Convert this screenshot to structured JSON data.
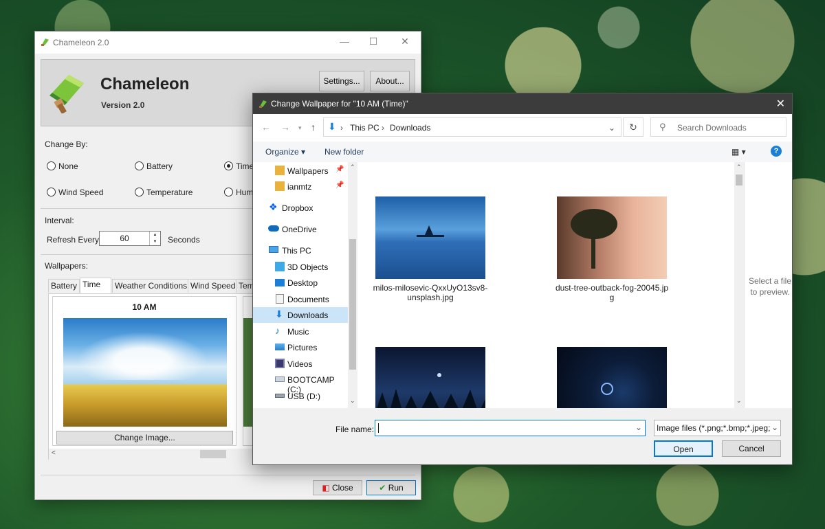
{
  "chameleon": {
    "window_title": "Chameleon 2.0",
    "app_name": "Chameleon",
    "version": "Version 2.0",
    "settings_label": "Settings...",
    "about_label": "About...",
    "change_by_label": "Change By:",
    "options": [
      "None",
      "Battery",
      "Time",
      "Wind Speed",
      "Temperature",
      "Hum"
    ],
    "selected_option": "Time",
    "interval_label": "Interval:",
    "refresh_every_label": "Refresh Every",
    "refresh_value": "60",
    "seconds_label": "Seconds",
    "wallpapers_label": "Wallpapers:",
    "tabs": [
      "Battery",
      "Time",
      "Weather Conditions",
      "Wind Speed",
      "Tem"
    ],
    "active_tab": "Time",
    "card_title": "10 AM",
    "change_image_label": "Change Image...",
    "close_label": "Close",
    "run_label": "Run"
  },
  "dialog": {
    "title": "Change Wallpaper for \"10 AM (Time)\"",
    "breadcrumb": [
      "This PC",
      "Downloads"
    ],
    "search_placeholder": "Search Downloads",
    "organize_label": "Organize",
    "new_folder_label": "New folder",
    "nav_items": [
      {
        "label": "Wallpapers",
        "icon": "folder-icon",
        "pinned": true
      },
      {
        "label": "ianmtz",
        "icon": "folder-icon",
        "pinned": true
      },
      {
        "label": "Dropbox",
        "icon": "dropbox-icon"
      },
      {
        "label": "OneDrive",
        "icon": "cloud-icon"
      },
      {
        "label": "This PC",
        "icon": "computer-icon"
      },
      {
        "label": "3D Objects",
        "icon": "cube-icon"
      },
      {
        "label": "Desktop",
        "icon": "desktop-icon"
      },
      {
        "label": "Documents",
        "icon": "document-icon"
      },
      {
        "label": "Downloads",
        "icon": "download-icon",
        "selected": true
      },
      {
        "label": "Music",
        "icon": "music-icon"
      },
      {
        "label": "Pictures",
        "icon": "pictures-icon"
      },
      {
        "label": "Videos",
        "icon": "video-icon"
      },
      {
        "label": "BOOTCAMP (C:)",
        "icon": "drive-icon"
      },
      {
        "label": "USB (D:)",
        "icon": "usb-drive-icon"
      }
    ],
    "files": [
      {
        "line1": "milos-milosevic-QxxUyO13sv8-",
        "line2": "unsplash.jpg"
      },
      {
        "line1": "dust-tree-outback-fog-20045.jp",
        "line2": "g"
      }
    ],
    "preview_text": "Select a file to preview.",
    "file_name_label": "File name:",
    "file_name_value": "",
    "filter_label": "Image files (*.png;*.bmp;*.jpeg;",
    "open_label": "Open",
    "cancel_label": "Cancel"
  },
  "colors": {
    "accent": "#0078d7",
    "selection": "#cce4f7",
    "dialog_titlebar": "#3c3c3c"
  }
}
